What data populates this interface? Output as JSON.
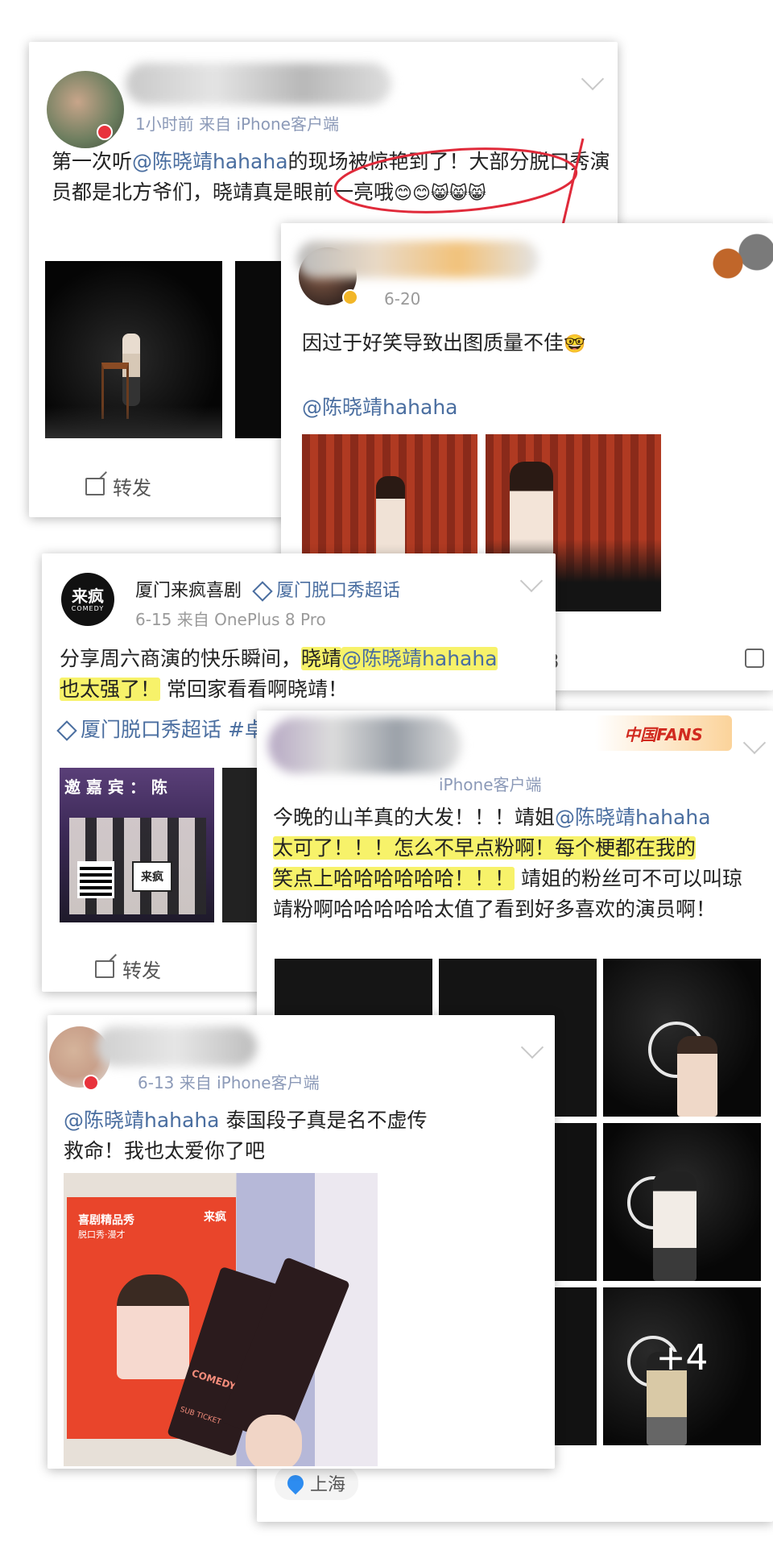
{
  "card1": {
    "meta": "1小时前  来自 iPhone客户端",
    "text_a": "第一次听",
    "mention": "@陈晓靖hahaha",
    "text_b": "的现场被惊艳到了！大部分脱口秀演员都是北方爷们，晓靖真是眼前一亮哦",
    "emoji": "😊😊😸😸😸",
    "repost_label": "转发"
  },
  "card2": {
    "date": "6-20",
    "text": "因过于好笑导致出图质量不佳",
    "emoji": "🤓",
    "mention": "@陈晓靖hahaha",
    "comment_count": "8"
  },
  "card3": {
    "name": "厦门来疯喜剧",
    "topic": "厦门脱口秀超话",
    "meta": "6-15  来自 OnePlus 8 Pro",
    "avatar_text": "来疯",
    "avatar_sub": "COMEDY",
    "text_a": "分享周六商演的快乐瞬间，",
    "hl_1": "晓靖",
    "mention": "@陈晓靖hahaha",
    "hl_2": "也太强了！",
    "text_b": "常回家看看啊晓靖！",
    "topic_line": "厦门脱口秀超话 #卓",
    "banner_text": "邀 嘉 宾 ： 陈",
    "sign_text": "来疯",
    "repost_label": "转发"
  },
  "card4": {
    "meta": "iPhone客户端",
    "badge": "中国FANS",
    "text_a": "今晚的山羊真的大发！！！靖姐",
    "mention": "@陈晓靖hahaha",
    "hl_1": "太可了！！！怎么不早点粉啊！每个梗都在我的",
    "hl_2": "笑点上哈哈哈哈哈哈！！！",
    "text_b": "靖姐的粉丝可不可以叫琼靖粉啊哈哈哈哈哈太值了看到好多喜欢的演员啊！",
    "more_count": "+4",
    "location": "上海"
  },
  "card5": {
    "meta": "6-13  来自 iPhone客户端",
    "mention": "@陈晓靖hahaha",
    "text_a": "泰国段子真是名不虚传",
    "text_b": "救命！我也太爱你了吧",
    "poster_title": "喜剧精品秀",
    "poster_sub": "脱口秀·漫才",
    "poster_brand": "来疯",
    "ticket_text": "COMEDY",
    "ticket_sub": "SUB TICKET"
  }
}
